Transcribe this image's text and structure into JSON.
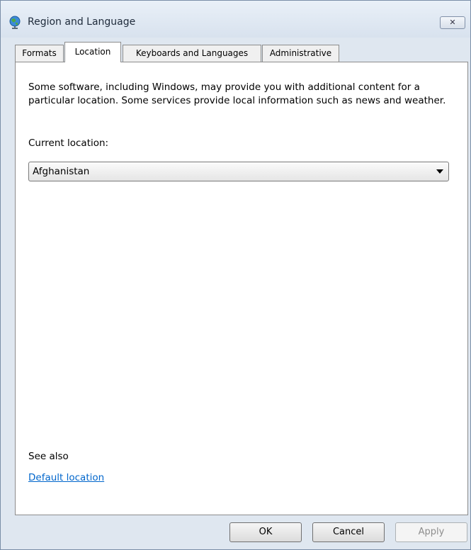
{
  "window": {
    "title": "Region and Language",
    "close_glyph": "✕"
  },
  "tabs": [
    {
      "label": "Formats",
      "active": false
    },
    {
      "label": "Location",
      "active": true
    },
    {
      "label": "Keyboards and Languages",
      "active": false
    },
    {
      "label": "Administrative",
      "active": false
    }
  ],
  "location": {
    "description": "Some software, including Windows, may provide you with additional content for a particular location. Some services provide local information such as news and weather.",
    "current_label": "Current location:",
    "current_value": "Afghanistan",
    "see_also": "See also",
    "default_link": "Default location"
  },
  "buttons": {
    "ok": "OK",
    "cancel": "Cancel",
    "apply": "Apply",
    "apply_enabled": false
  },
  "icons": {
    "title": "globe-icon",
    "close": "close-icon",
    "dropdown": "chevron-down-icon"
  },
  "colors": {
    "link": "#0066cc",
    "window_frame": "#dfe7f0",
    "panel": "#ffffff"
  }
}
